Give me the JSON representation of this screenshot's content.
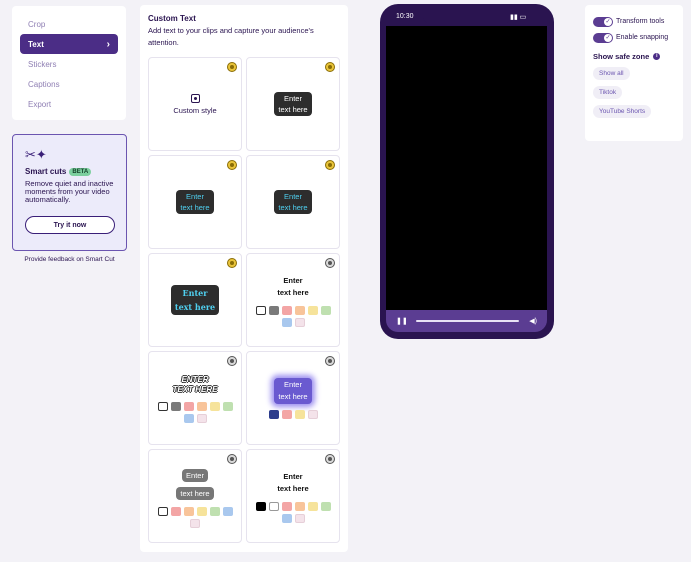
{
  "nav": {
    "items": [
      {
        "label": "Crop"
      },
      {
        "label": "Text",
        "active": true
      },
      {
        "label": "Stickers"
      },
      {
        "label": "Captions"
      },
      {
        "label": "Export"
      }
    ]
  },
  "smart_cuts": {
    "icon": "scissors-sparkle-icon",
    "title": "Smart cuts",
    "badge": "BETA",
    "description": "Remove quiet and inactive moments from your video automatically.",
    "button": "Try it now",
    "feedback": "Provide feedback on Smart Cut"
  },
  "text_panel": {
    "title": "Custom Text",
    "description": "Add text to your clips and capture your audience's attention.",
    "custom_label": "Custom style",
    "line1": "Enter",
    "line2": "text here",
    "outline_text_1": "ENTER",
    "outline_text_2": "TEXT HERE"
  },
  "phone": {
    "time": "10:30",
    "status": "signal-wifi-battery"
  },
  "settings": {
    "transform_tools": "Transform tools",
    "enable_snapping": "Enable snapping",
    "safe_zone_title": "Show safe zone",
    "chips": [
      "Show all",
      "Tiktok",
      "YouTube Shorts"
    ]
  },
  "colors": {
    "brand": "#4b2d86",
    "premium_badge": "#e9c43a",
    "swatches": [
      "#ffffff",
      "#7a7a7a",
      "#f3a5a5",
      "#f8c49a",
      "#f6e39b",
      "#bfe0b0",
      "#a9c8ee",
      "#f4e3ea"
    ]
  }
}
